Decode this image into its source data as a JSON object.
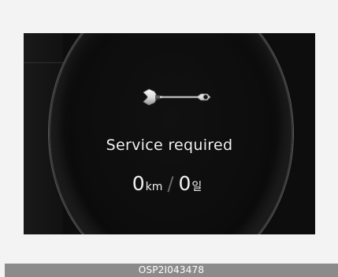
{
  "display": {
    "message": "Service required",
    "distance_value": "0",
    "distance_unit": "km",
    "separator": "/",
    "days_value": "0",
    "days_unit": "일",
    "icon": "wrench-icon"
  },
  "footer": {
    "code": "OSP2I043478"
  },
  "colors": {
    "panel": "#0d0d0d",
    "text": "#efefef",
    "footer_bg": "#8b8b8b"
  }
}
